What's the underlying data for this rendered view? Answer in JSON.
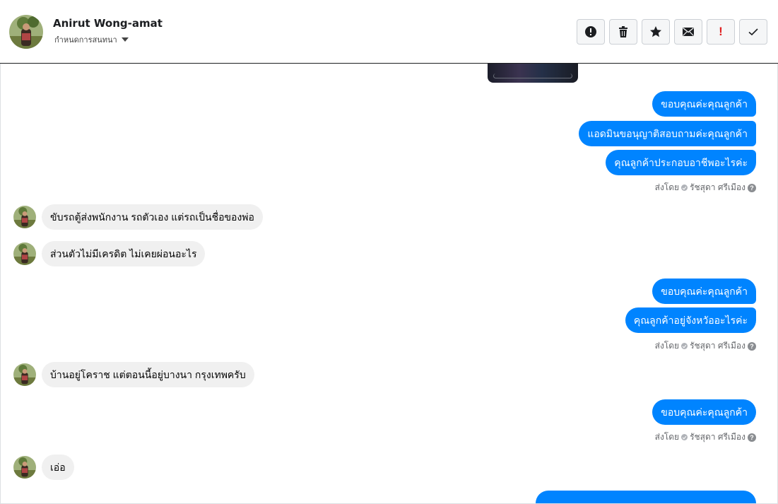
{
  "header": {
    "contact_name": "Anirut Wong-amat",
    "assign_label": "กำหนดการสนทนา",
    "toolbar": [
      {
        "name": "report-spam-button",
        "icon": "alert-circle-icon"
      },
      {
        "name": "delete-button",
        "icon": "trash-icon"
      },
      {
        "name": "star-button",
        "icon": "star-icon"
      },
      {
        "name": "mark-unread-button",
        "icon": "envelope-icon"
      },
      {
        "name": "important-button",
        "icon": "exclamation-icon"
      },
      {
        "name": "mark-done-button",
        "icon": "check-icon"
      }
    ]
  },
  "messages": {
    "group1": [
      "ขอบคุณค่ะคุณลูกค้า",
      "แอดมินขอนุญาติสอบถามค่ะคุณลูกค้า",
      "คุณลูกค้าประกอบอาชีพอะไรค่ะ"
    ],
    "incoming1": "ขับรถตู้ส่งพนักงาน รถตัวเอง แต่รถเป็นชื่อของพ่อ",
    "incoming2": "ส่วนตัวไม่มีเครดิต ไม่เคยผ่อนอะไร",
    "group2": [
      "ขอบคุณค่ะคุณลูกค้า",
      "คุณลูกค้าอยู่จังหวัออะไรค่ะ"
    ],
    "incoming3": "บ้านอยู่โคราช แต่ตอนนี้อยู่บางนา กรุงเทพครับ",
    "group3": [
      "ขอบคุณค่ะคุณลูกค้า"
    ],
    "incoming4": "เอ่อ",
    "sent_by_label": "ส่งโดย",
    "sender_name": "รัชสุดา ศรีเมือง",
    "help_glyph": "?"
  },
  "colors": {
    "outgoing_bubble": "#0084ff",
    "incoming_bubble": "#f0f0f0"
  }
}
